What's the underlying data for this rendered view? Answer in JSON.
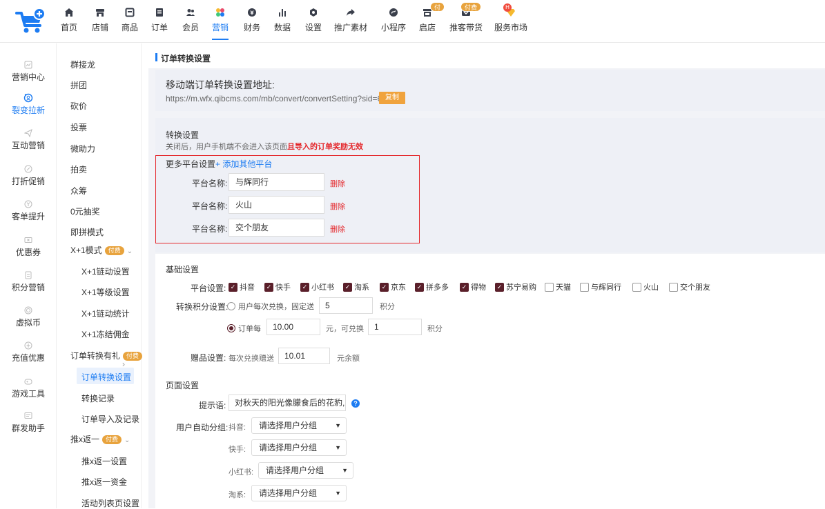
{
  "nav": [
    {
      "label": "首页",
      "icon": "home-icon"
    },
    {
      "label": "店铺",
      "icon": "store-icon"
    },
    {
      "label": "商品",
      "icon": "product-icon"
    },
    {
      "label": "订单",
      "icon": "order-icon"
    },
    {
      "label": "会员",
      "icon": "member-icon"
    },
    {
      "label": "营销",
      "icon": "marketing-icon",
      "active": true
    },
    {
      "label": "财务",
      "icon": "finance-icon"
    },
    {
      "label": "数据",
      "icon": "data-icon"
    },
    {
      "label": "设置",
      "icon": "settings-icon"
    },
    {
      "label": "推广素材",
      "icon": "share-icon"
    },
    {
      "label": "小程序",
      "icon": "miniprogram-icon"
    },
    {
      "label": "启店",
      "icon": "open-store-icon",
      "badge": "付费"
    },
    {
      "label": "推客带货",
      "icon": "promoter-icon",
      "badge": "付费"
    },
    {
      "label": "服务市场",
      "icon": "diamond-icon",
      "hot": "H"
    }
  ],
  "sidebar1": [
    {
      "label": "营销中心",
      "icon": "chart-icon"
    },
    {
      "label": "裂变拉新",
      "icon": "fission-icon",
      "active": true
    },
    {
      "label": "互动营销",
      "icon": "send-icon"
    },
    {
      "label": "打折促销",
      "icon": "discount-icon"
    },
    {
      "label": "客单提升",
      "icon": "yen-icon"
    },
    {
      "label": "优惠券",
      "icon": "coupon-icon"
    },
    {
      "label": "积分营销",
      "icon": "points-icon"
    },
    {
      "label": "虚拟币",
      "icon": "coin-icon"
    },
    {
      "label": "充值优惠",
      "icon": "recharge-icon"
    },
    {
      "label": "游戏工具",
      "icon": "gamepad-icon"
    },
    {
      "label": "群发助手",
      "icon": "broadcast-icon"
    }
  ],
  "sidebar2": {
    "items": [
      "群接龙",
      "拼团",
      "砍价",
      "投票",
      "微助力",
      "拍卖",
      "众筹",
      "0元抽奖",
      "即拼模式"
    ],
    "x1_group": "X+1模式",
    "x1_badge": "付费",
    "x1_subs": [
      "X+1链动设置",
      "X+1等级设置",
      "X+1链动统计",
      "X+1冻结佣金"
    ],
    "convert_group": "订单转换有礼",
    "convert_badge": "付费",
    "convert_subs": [
      "订单转换设置",
      "转换记录",
      "订单导入及记录"
    ],
    "tui_group": "推x返一",
    "tui_badge": "付费",
    "tui_subs": [
      "推x返一设置",
      "推x返一资金",
      "活动列表页设置"
    ]
  },
  "page_title": "订单转换设置",
  "mobile": {
    "label": "移动端订单转换设置地址:",
    "url": "https://m.wfx.qibcms.com/mb/convert/convertSetting?sid=6",
    "copy": "复制"
  },
  "convert": {
    "heading": "转换设置",
    "desc_normal": "关闭后，用户手机端不会进入该页面",
    "desc_red": "且导入的订单奖励无效",
    "more_label": "更多平台设置",
    "add_link": "+ 添加其他平台",
    "platform_label": "平台名称:",
    "delete": "删除",
    "platforms": [
      "与辉同行",
      "火山",
      "交个朋友"
    ]
  },
  "basic": {
    "heading": "基础设置",
    "platform_label": "平台设置:",
    "platforms": [
      {
        "name": "抖音",
        "checked": true
      },
      {
        "name": "快手",
        "checked": true
      },
      {
        "name": "小红书",
        "checked": true
      },
      {
        "name": "淘系",
        "checked": true
      },
      {
        "name": "京东",
        "checked": true
      },
      {
        "name": "拼多多",
        "checked": true
      },
      {
        "name": "得物",
        "checked": true
      },
      {
        "name": "苏宁易购",
        "checked": true
      },
      {
        "name": "天猫",
        "checked": false
      },
      {
        "name": "与辉同行",
        "checked": false
      },
      {
        "name": "火山",
        "checked": false
      },
      {
        "name": "交个朋友",
        "checked": false
      }
    ],
    "points_label": "转换积分设置:",
    "opt1_text": "用户每次兑换，固定送",
    "opt1_value": "5",
    "opt1_unit": "积分",
    "opt2_text": "订单每",
    "opt2_value": "10.00",
    "opt2_mid": "元，可兑换",
    "opt2_value2": "1",
    "opt2_unit": "积分",
    "gift_label": "赠品设置:",
    "gift_text": "每次兑换赠送",
    "gift_value": "10.01",
    "gift_unit": "元余额"
  },
  "page_settings": {
    "heading": "页面设置",
    "tip_label": "提示语:",
    "tip_value": "对秋天的阳光像朦食后的花豹, ›",
    "group_label": "用户自动分组:",
    "groups": [
      {
        "platform": "抖音:",
        "value": "请选择用户分组"
      },
      {
        "platform": "快手:",
        "value": "请选择用户分组"
      },
      {
        "platform": "小红书:",
        "value": "请选择用户分组"
      },
      {
        "platform": "淘系:",
        "value": "请选择用户分组"
      }
    ]
  },
  "colors": {
    "accent": "#1d7cf2",
    "danger": "#e4262a",
    "badge": "#e8a33d",
    "check": "#5a1f2a"
  }
}
